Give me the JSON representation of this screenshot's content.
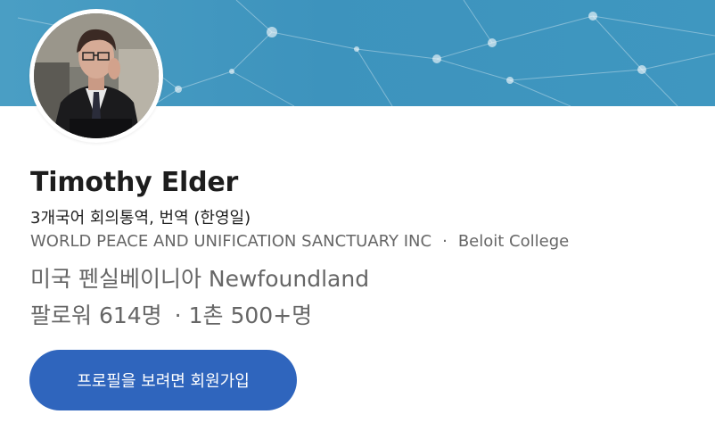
{
  "profile": {
    "name": "Timothy Elder",
    "headline": "3개국어 회의통역, 번역 (한영일)",
    "company": "WORLD PEACE AND UNIFICATION SANCTUARY INC",
    "separator": "·",
    "school": "Beloit College",
    "location": "미국 펜실베이니아 Newfoundland",
    "followers": "팔로워 614명",
    "connections": "1촌 500+명"
  },
  "actions": {
    "join_label": "프로필을 보려면 회원가입"
  },
  "colors": {
    "banner": "#3f97c0",
    "button": "#2f65bd",
    "name_text": "#1d1d1d",
    "secondary_text": "#666666"
  }
}
